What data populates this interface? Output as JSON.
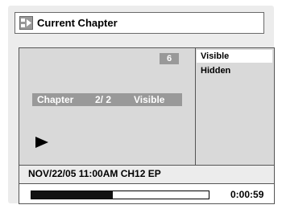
{
  "header": {
    "title": "Current Chapter",
    "icon": "chapter-icon"
  },
  "screen": {
    "badge": "6",
    "chapter_label": "Chapter",
    "chapter_value": "2/ 2",
    "chapter_state": "Visible",
    "play_icon": "play-icon"
  },
  "menu": {
    "items": [
      {
        "label": "Visible",
        "selected": true
      },
      {
        "label": "Hidden",
        "selected": false
      }
    ]
  },
  "status": {
    "info": "NOV/22/05 11:00AM CH12 EP",
    "progress_fraction": 0.46,
    "time": "0:00:59"
  },
  "colors": {
    "background": "#ececec",
    "highlight": "#999999",
    "progress": "#111111"
  }
}
